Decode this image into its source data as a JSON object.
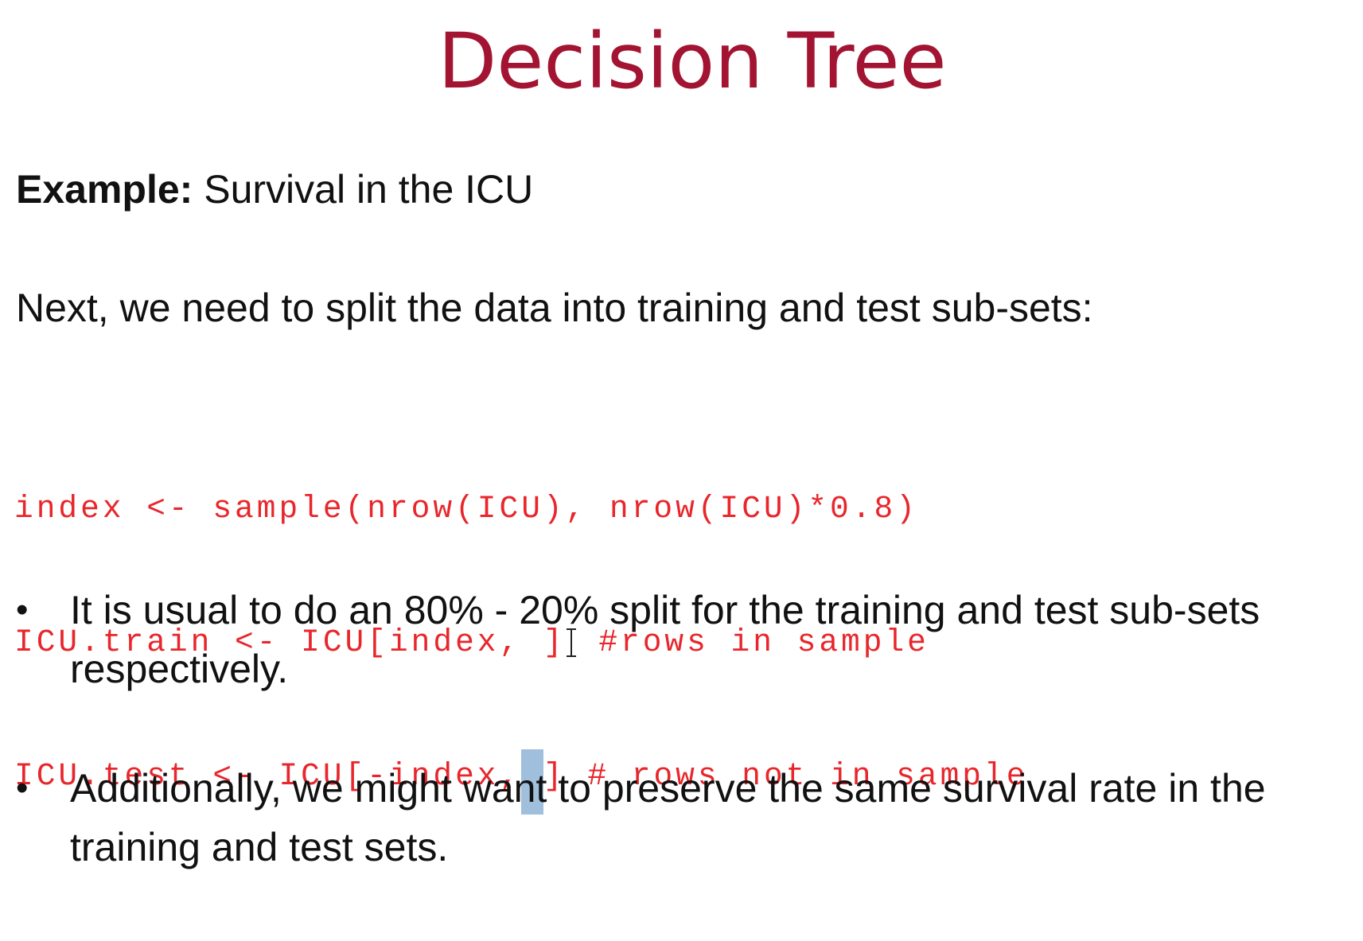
{
  "slide": {
    "title": "Decision Tree",
    "example_label": "Example:",
    "example_text": " Survival in the ICU",
    "intro": "Next, we need to split the data into training and test sub-sets:",
    "code": {
      "line1": "index <- sample(nrow(ICU), nrow(ICU)*0.8)",
      "line2_a": "ICU.train <- ICU[index, ]",
      "line2_b": " #rows in sample",
      "line3_a": "ICU.test <- ICU[-index,",
      "line3_sel": " ",
      "line3_b": "] # rows not in sample"
    },
    "bullets": [
      "It is usual to do an 80% - 20% split for the training and test sub-sets respectively.",
      "Additionally, we might want to preserve the same survival rate in the training and test sets."
    ],
    "bullet_symbol": "•",
    "colors": {
      "title": "#a31432",
      "code": "#e8262b",
      "selection": "#9fbfdc"
    },
    "icons": {
      "text_cursor": "i-beam-cursor-icon"
    }
  }
}
